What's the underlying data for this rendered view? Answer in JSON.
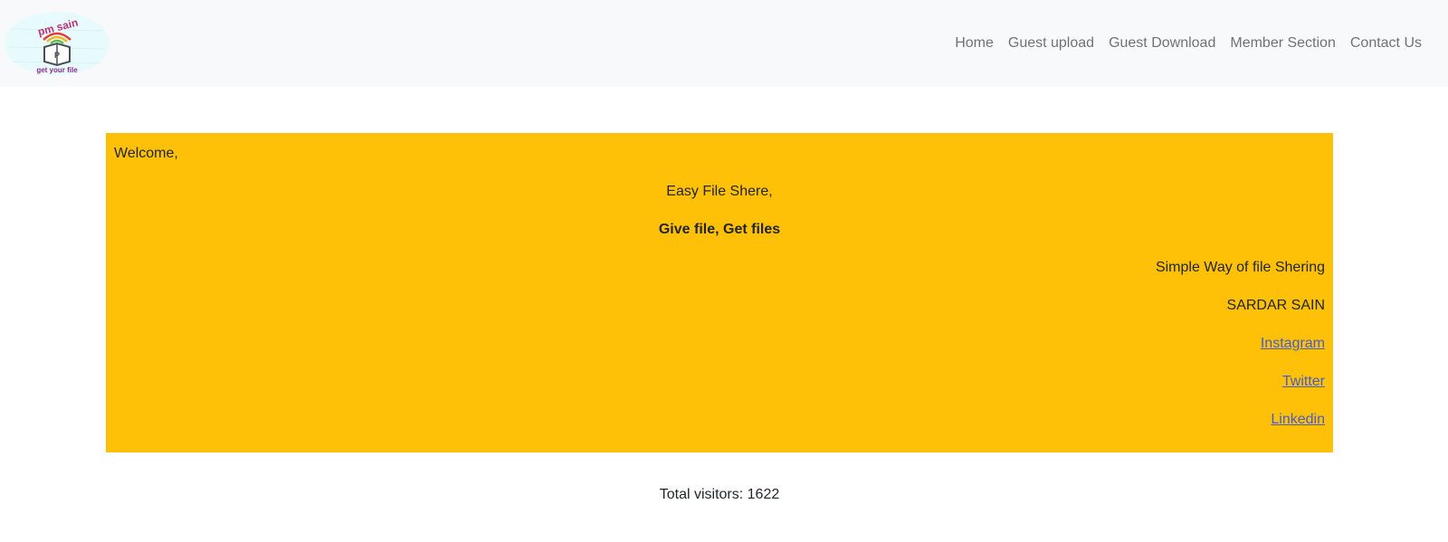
{
  "brand": {
    "logo_top_text": "pm sain",
    "logo_bottom_text": "get your file",
    "logo_letter": "P"
  },
  "nav": {
    "items": [
      {
        "label": "Home"
      },
      {
        "label": "Guest upload"
      },
      {
        "label": "Guest Download"
      },
      {
        "label": "Member Section"
      },
      {
        "label": "Contact Us"
      }
    ]
  },
  "hero": {
    "welcome": "Welcome,",
    "tagline": "Easy File Shere,",
    "slogan": "Give file, Get files",
    "subtitle": "Simple Way of file Shering",
    "author": "SARDAR SAIN",
    "links": [
      {
        "label": "Instagram"
      },
      {
        "label": "Twitter"
      },
      {
        "label": "Linkedin"
      }
    ]
  },
  "footer": {
    "visitors": "Total visitors: 1622"
  },
  "colors": {
    "hero_background": "#ffc107",
    "navbar_background": "#f8f9fa",
    "link": "#4a5cc7"
  }
}
